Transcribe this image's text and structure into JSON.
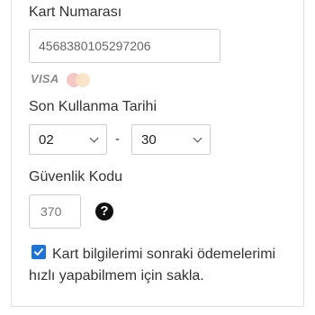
{
  "card_number": {
    "label": "Kart Numarası",
    "value": "4568380105297206"
  },
  "brands": {
    "visa_label": "VISA",
    "visa_icon": "visa-logo",
    "mastercard_icon": "mastercard-logo"
  },
  "expiry": {
    "label": "Son Kullanma Tarihi",
    "month": "02",
    "separator": "-",
    "year": "30"
  },
  "security_code": {
    "label": "Güvenlik Kodu",
    "placeholder": "370",
    "help_icon": "question-circle-icon",
    "help_glyph": "?"
  },
  "save_card": {
    "checked": true,
    "label": "Kart bilgilerimi sonraki ödemelerimi hızlı yapabilmem için sakla."
  },
  "colors": {
    "checkbox_blue": "#1e73d6",
    "text": "#333333",
    "border": "#cfcfcf"
  }
}
